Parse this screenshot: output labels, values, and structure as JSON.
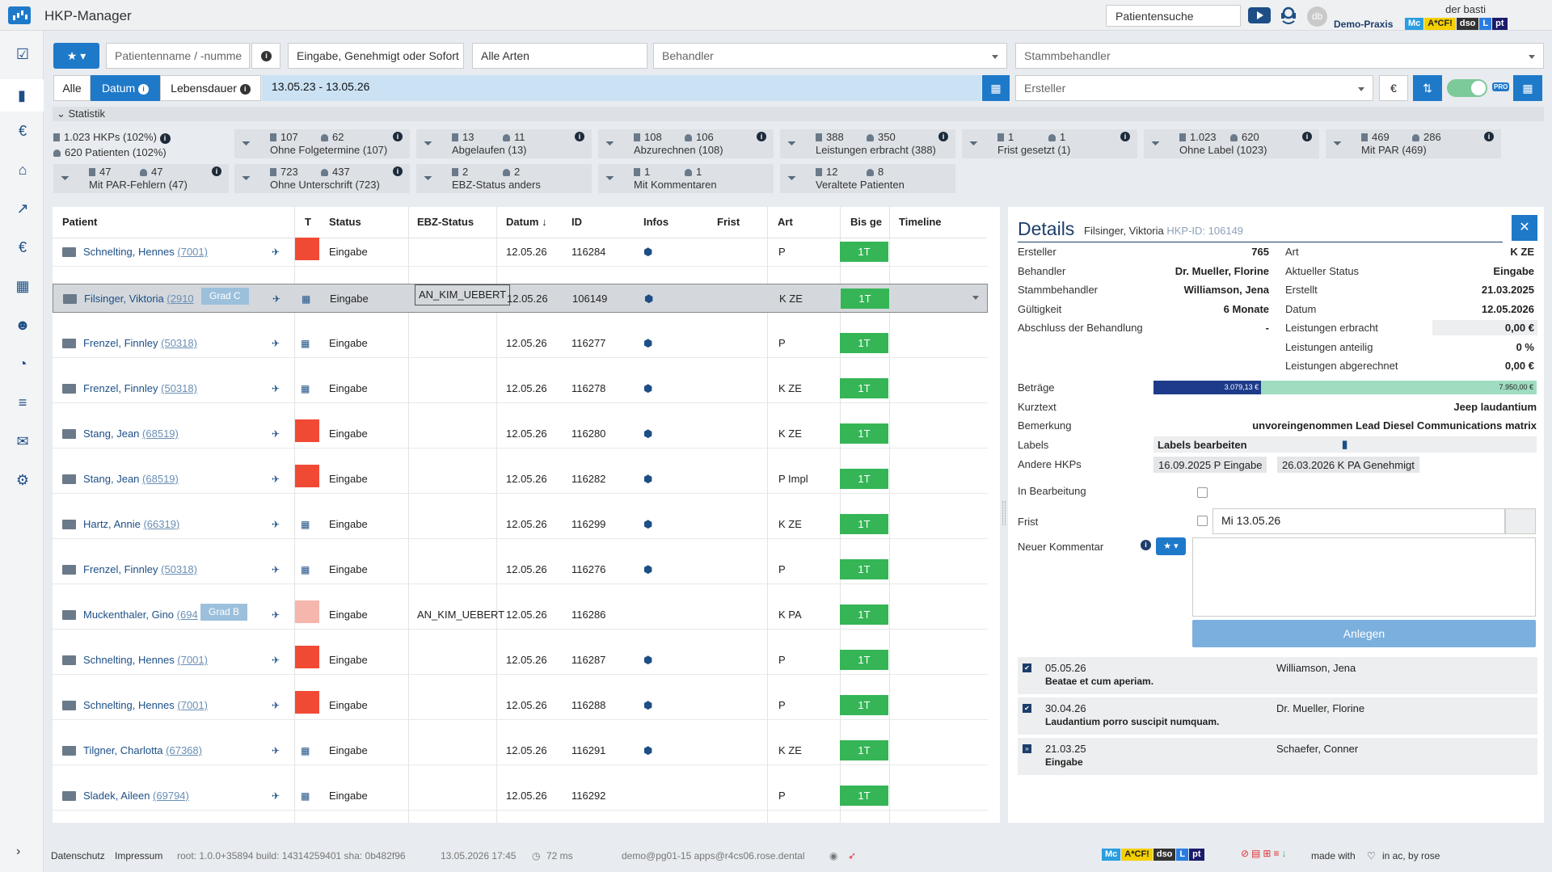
{
  "app": {
    "title": "HKP-Manager",
    "patient_search": "Patientensuche",
    "user": "der basti",
    "practice": "Demo-Praxis",
    "avatar_initials": "db",
    "badges": [
      "Mc",
      "A*CF!",
      "dso",
      "L",
      "pt"
    ]
  },
  "filters": {
    "name_placeholder": "Patientenname / -numme",
    "status_value": "Eingabe, Genehmigt oder Sofort",
    "art_value": "Alle Arten",
    "behandler_placeholder": "Behandler",
    "stammbehandler_placeholder": "Stammbehandler",
    "ersteller_placeholder": "Ersteller",
    "tabs": [
      "Alle",
      "Datum",
      "Lebensdauer"
    ],
    "active_tab": "Datum",
    "date_range": "13.05.23 - 13.05.26",
    "currency": "€",
    "pro": "PRO"
  },
  "statistik": {
    "label": "Statistik",
    "total_hkps": "1.023 HKPs (102%)",
    "total_patients": "620 Patienten (102%)",
    "cards": [
      {
        "n1": "107",
        "n2": "62",
        "label": "Ohne Folgetermine (107)",
        "info": true
      },
      {
        "n1": "13",
        "n2": "11",
        "label": "Abgelaufen (13)",
        "info": true
      },
      {
        "n1": "108",
        "n2": "106",
        "label": "Abzurechnen (108)",
        "info": true
      },
      {
        "n1": "388",
        "n2": "350",
        "label": "Leistungen erbracht (388)",
        "info": true
      },
      {
        "n1": "1",
        "n2": "1",
        "label": "Frist gesetzt (1)",
        "info": true
      },
      {
        "n1": "1.023",
        "n2": "620",
        "label": "Ohne Label (1023)",
        "info": true
      },
      {
        "n1": "469",
        "n2": "286",
        "label": "Mit PAR (469)",
        "info": true
      },
      {
        "n1": "47",
        "n2": "47",
        "label": "Mit PAR-Fehlern (47)",
        "info": true
      },
      {
        "n1": "723",
        "n2": "437",
        "label": "Ohne Unterschrift (723)",
        "info": true
      },
      {
        "n1": "2",
        "n2": "2",
        "label": "EBZ-Status anders",
        "info": false
      },
      {
        "n1": "1",
        "n2": "1",
        "label": "Mit Kommentaren",
        "info": false
      },
      {
        "n1": "12",
        "n2": "8",
        "label": "Veraltete Patienten",
        "info": false
      }
    ]
  },
  "table": {
    "headers": {
      "patient": "Patient",
      "t": "T",
      "status": "Status",
      "ebz": "EBZ-Status",
      "datum": "Datum",
      "id": "ID",
      "infos": "Infos",
      "frist": "Frist",
      "art": "Art",
      "bis": "Bis ge",
      "timeline": "Timeline"
    },
    "rows": [
      {
        "last": "Schnelting,",
        "first": "Hennes",
        "pid": "(7001)",
        "grade": "",
        "t": "red",
        "status": "Eingabe",
        "ebz": "",
        "date": "12.05.26",
        "id": "116284",
        "tag": true,
        "art": "P",
        "bis": "1T"
      },
      {
        "last": "Filsinger,",
        "first": "Viktoria",
        "pid": "(2910",
        "grade": "Grad C",
        "t": "cal",
        "status": "Eingabe",
        "ebz": "AN_KIM_UEBERT",
        "date": "12.05.26",
        "id": "106149",
        "tag": true,
        "art": "K ZE",
        "bis": "1T",
        "selected": true
      },
      {
        "last": "Frenzel,",
        "first": "Finnley",
        "pid": "(50318)",
        "grade": "",
        "t": "cal",
        "status": "Eingabe",
        "ebz": "",
        "date": "12.05.26",
        "id": "116277",
        "tag": true,
        "art": "P",
        "bis": "1T"
      },
      {
        "last": "Frenzel,",
        "first": "Finnley",
        "pid": "(50318)",
        "grade": "",
        "t": "cal",
        "status": "Eingabe",
        "ebz": "",
        "date": "12.05.26",
        "id": "116278",
        "tag": true,
        "art": "K ZE",
        "bis": "1T"
      },
      {
        "last": "Stang,",
        "first": "Jean",
        "pid": "(68519)",
        "grade": "",
        "t": "red",
        "status": "Eingabe",
        "ebz": "",
        "date": "12.05.26",
        "id": "116280",
        "tag": true,
        "art": "K ZE",
        "bis": "1T"
      },
      {
        "last": "Stang,",
        "first": "Jean",
        "pid": "(68519)",
        "grade": "",
        "t": "red",
        "status": "Eingabe",
        "ebz": "",
        "date": "12.05.26",
        "id": "116282",
        "tag": true,
        "art": "P Impl",
        "bis": "1T"
      },
      {
        "last": "Hartz,",
        "first": "Annie",
        "pid": "(66319)",
        "grade": "",
        "t": "cal",
        "status": "Eingabe",
        "ebz": "",
        "date": "12.05.26",
        "id": "116299",
        "tag": true,
        "art": "K ZE",
        "bis": "1T"
      },
      {
        "last": "Frenzel,",
        "first": "Finnley",
        "pid": "(50318)",
        "grade": "",
        "t": "cal",
        "status": "Eingabe",
        "ebz": "",
        "date": "12.05.26",
        "id": "116276",
        "tag": true,
        "art": "P",
        "bis": "1T"
      },
      {
        "last": "Muckenthaler,",
        "first": "Gino",
        "pid": "(694",
        "grade": "Grad B",
        "t": "pink",
        "status": "Eingabe",
        "ebz": "AN_KIM_UEBERT",
        "date": "12.05.26",
        "id": "116286",
        "tag": false,
        "art": "K PA",
        "bis": "1T"
      },
      {
        "last": "Schnelting,",
        "first": "Hennes",
        "pid": "(7001)",
        "grade": "",
        "t": "red",
        "status": "Eingabe",
        "ebz": "",
        "date": "12.05.26",
        "id": "116287",
        "tag": true,
        "art": "P",
        "bis": "1T"
      },
      {
        "last": "Schnelting,",
        "first": "Hennes",
        "pid": "(7001)",
        "grade": "",
        "t": "red",
        "status": "Eingabe",
        "ebz": "",
        "date": "12.05.26",
        "id": "116288",
        "tag": true,
        "art": "P",
        "bis": "1T"
      },
      {
        "last": "Tilgner,",
        "first": "Charlotta",
        "pid": "(67368)",
        "grade": "",
        "t": "cal",
        "status": "Eingabe",
        "ebz": "",
        "date": "12.05.26",
        "id": "116291",
        "tag": true,
        "art": "K ZE",
        "bis": "1T"
      },
      {
        "last": "Sladek,",
        "first": "Aileen",
        "pid": "(69794)",
        "grade": "",
        "t": "cal",
        "status": "Eingabe",
        "ebz": "",
        "date": "12.05.26",
        "id": "116292",
        "tag": false,
        "art": "P",
        "bis": "1T"
      }
    ]
  },
  "details": {
    "title": "Details",
    "patient": "Filsinger, Viktoria",
    "hkp_id": "HKP-ID: 106149",
    "left": [
      {
        "label": "Ersteller",
        "value": "765"
      },
      {
        "label": "Behandler",
        "value": "Dr. Mueller, Florine"
      },
      {
        "label": "Stammbehandler",
        "value": "Williamson, Jena"
      },
      {
        "label": "Gültigkeit",
        "value": "6 Monate"
      },
      {
        "label": "Abschluss der Behandlung",
        "value": "-"
      }
    ],
    "right": [
      {
        "label": "Art",
        "value": "K ZE"
      },
      {
        "label": "Aktueller Status",
        "value": "Eingabe"
      },
      {
        "label": "Erstellt",
        "value": "21.03.2025"
      },
      {
        "label": "Datum",
        "value": "12.05.2026"
      },
      {
        "label": "Leistungen erbracht",
        "value": "0,00 €"
      },
      {
        "label": "Leistungen anteilig",
        "value": "0 %"
      },
      {
        "label": "Leistungen abgerechnet",
        "value": "0,00 €"
      }
    ],
    "betraege_label": "Beträge",
    "betraege_a": "3.079,13 €",
    "betraege_b": "7.950,00 €",
    "betraege_fraction": 0.281,
    "kurztext_label": "Kurztext",
    "kurztext": "Jeep laudantium",
    "bemerkung_label": "Bemerkung",
    "bemerkung": "unvoreingenommen Lead Diesel Communications matrix",
    "labels_label": "Labels",
    "labels_btn": "Labels bearbeiten",
    "andere_label": "Andere HKPs",
    "andere": [
      "16.09.2025  P  Eingabe",
      "26.03.2026  K PA  Genehmigt"
    ],
    "in_bearbeitung": "In Bearbeitung",
    "frist_label": "Frist",
    "frist_value": "Mi 13.05.26",
    "neuer_kommentar": "Neuer Kommentar",
    "anlegen": "Anlegen",
    "comments": [
      {
        "date": "05.05.26",
        "name": "Williamson, Jena",
        "text": "Beatae et cum aperiam."
      },
      {
        "date": "30.04.26",
        "name": "Dr. Mueller, Florine",
        "text": "Laudantium porro suscipit numquam."
      },
      {
        "date": "21.03.25",
        "name": "Schaefer, Conner",
        "text": "Eingabe"
      }
    ]
  },
  "footer": {
    "datenschutz": "Datenschutz",
    "impressum": "Impressum",
    "build": "root: 1.0.0+35894  build: 14314259401  sha: 0b482f96",
    "timestamp": "13.05.2026 17:45",
    "timing": "72 ms",
    "server": "demo@pg01-15  apps@r4cs06.rose.dental",
    "made_with": "made with",
    "in_ac": "in ac, by rose"
  },
  "colors": {
    "accent": "#1f79c9",
    "green": "#35b556",
    "red": "#f04a35"
  }
}
